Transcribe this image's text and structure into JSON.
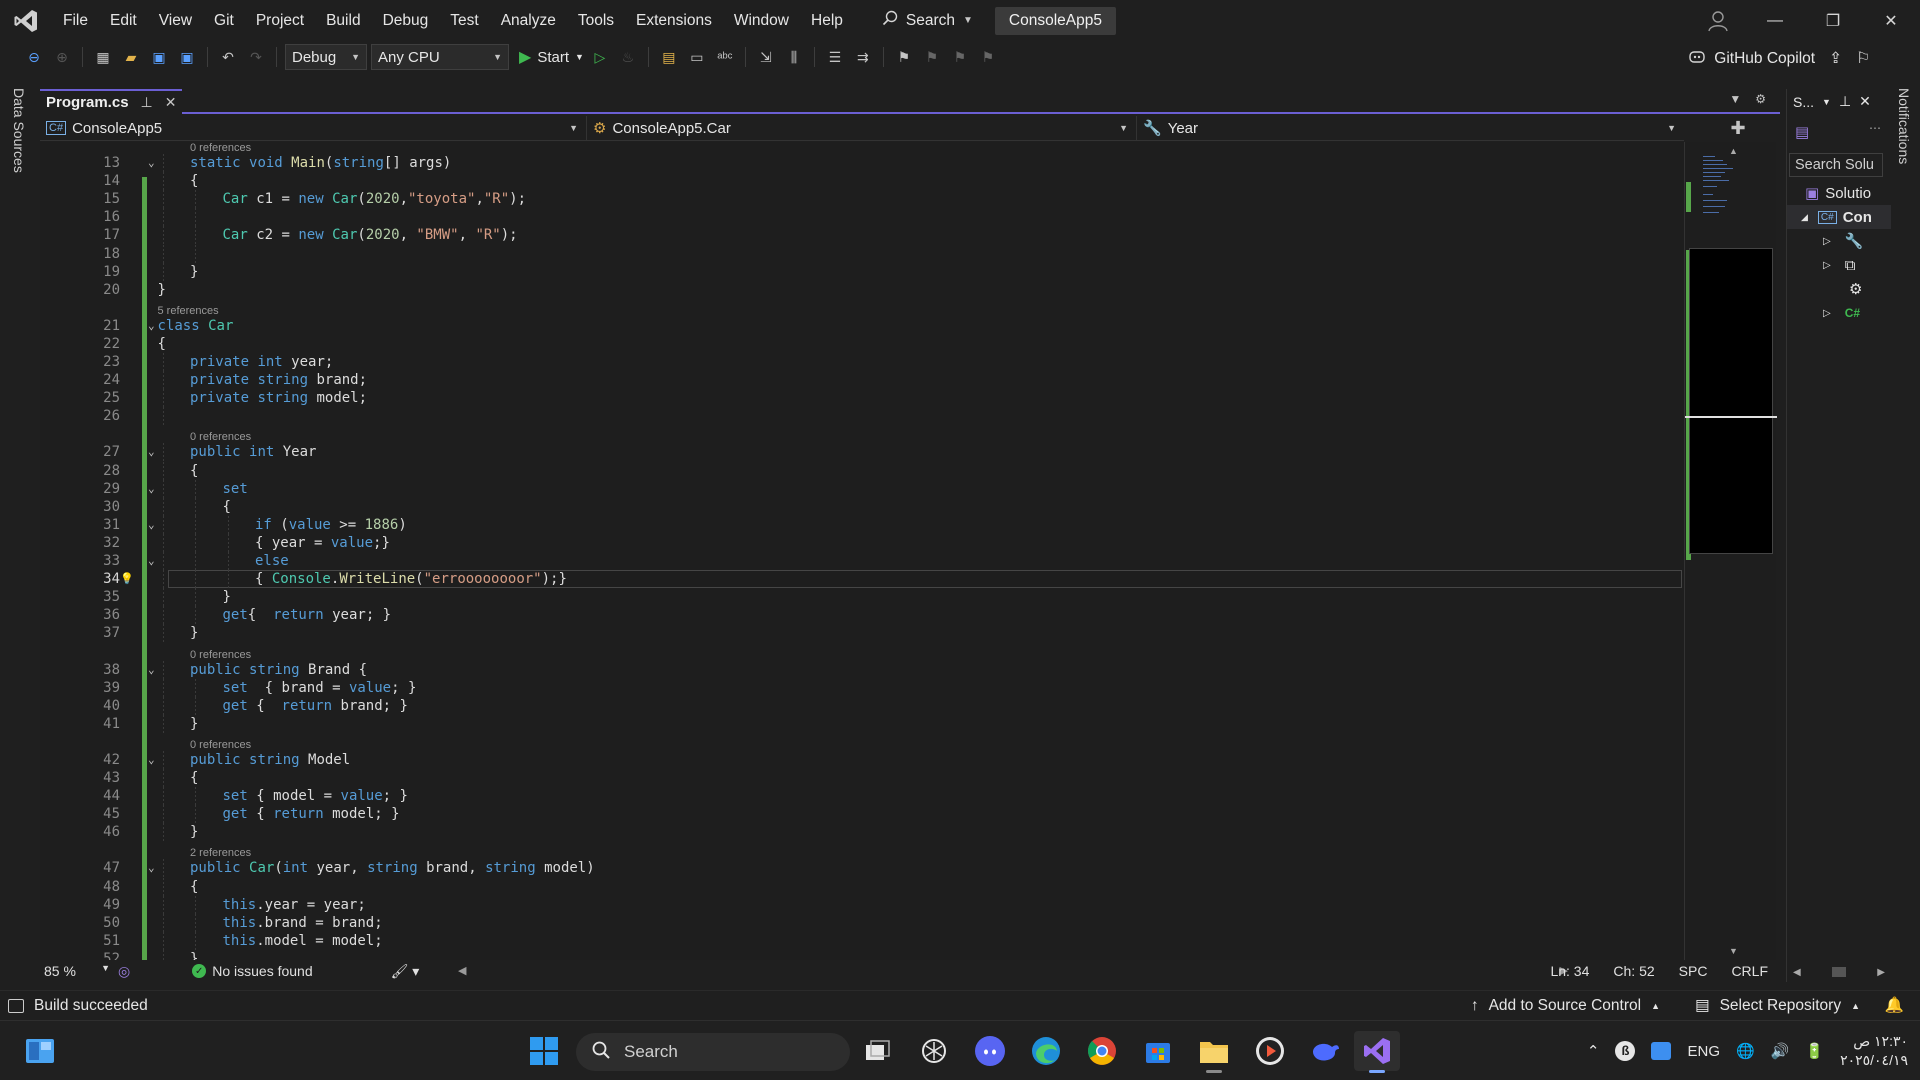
{
  "menu": {
    "items": [
      "File",
      "Edit",
      "View",
      "Git",
      "Project",
      "Build",
      "Debug",
      "Test",
      "Analyze",
      "Tools",
      "Extensions",
      "Window",
      "Help"
    ],
    "search_label": "Search",
    "solution_name": "ConsoleApp5"
  },
  "toolbar": {
    "configuration": "Debug",
    "platform": "Any CPU",
    "start_label": "Start",
    "copilot_label": "GitHub Copilot"
  },
  "side_tabs": {
    "left": "Data Sources",
    "right": "Notifications"
  },
  "editor": {
    "tab_title": "Program.cs",
    "nav_project": "ConsoleApp5",
    "nav_type": "ConsoleApp5.Car",
    "nav_member": "Year",
    "current_line": 34,
    "lines": [
      {
        "n": 13,
        "tokens": [
          [
            "k",
            "static"
          ],
          [
            "",
            " "
          ],
          [
            "k",
            "void"
          ],
          [
            "",
            " "
          ],
          [
            "m",
            "Main"
          ],
          [
            "",
            "("
          ],
          [
            "k",
            "string"
          ],
          [
            "",
            "[] "
          ],
          [
            "",
            "args"
          ],
          [
            "",
            ")"
          ]
        ],
        "indent": 2,
        "refs": "0 references"
      },
      {
        "n": 14,
        "tokens": [
          [
            "",
            "{"
          ]
        ],
        "indent": 2
      },
      {
        "n": 15,
        "tokens": [
          [
            "t",
            "Car"
          ],
          [
            "",
            " c1 = "
          ],
          [
            "k",
            "new"
          ],
          [
            "",
            " "
          ],
          [
            "t",
            "Car"
          ],
          [
            "",
            "("
          ],
          [
            "n",
            "2020"
          ],
          [
            "",
            ","
          ],
          [
            "s",
            "\"toyota\""
          ],
          [
            "",
            ","
          ],
          [
            "s",
            "\"R\""
          ],
          [
            "",
            ");"
          ]
        ],
        "indent": 3
      },
      {
        "n": 16,
        "tokens": [],
        "indent": 3
      },
      {
        "n": 17,
        "tokens": [
          [
            "t",
            "Car"
          ],
          [
            "",
            " c2 = "
          ],
          [
            "k",
            "new"
          ],
          [
            "",
            " "
          ],
          [
            "t",
            "Car"
          ],
          [
            "",
            "("
          ],
          [
            "n",
            "2020"
          ],
          [
            "",
            ", "
          ],
          [
            "s",
            "\"BMW\""
          ],
          [
            "",
            ", "
          ],
          [
            "s",
            "\"R\""
          ],
          [
            "",
            ");"
          ]
        ],
        "indent": 3
      },
      {
        "n": 18,
        "tokens": [],
        "indent": 3
      },
      {
        "n": 19,
        "tokens": [
          [
            "",
            "}"
          ]
        ],
        "indent": 2
      },
      {
        "n": 20,
        "tokens": [
          [
            "",
            "}"
          ]
        ],
        "indent": 1
      },
      {
        "n": 21,
        "tokens": [
          [
            "k",
            "class"
          ],
          [
            "",
            " "
          ],
          [
            "cls",
            "Car"
          ]
        ],
        "indent": 1,
        "refs": "5 references"
      },
      {
        "n": 22,
        "tokens": [
          [
            "",
            "{"
          ]
        ],
        "indent": 1
      },
      {
        "n": 23,
        "tokens": [
          [
            "k",
            "private"
          ],
          [
            "",
            " "
          ],
          [
            "k",
            "int"
          ],
          [
            "",
            " year;"
          ]
        ],
        "indent": 2
      },
      {
        "n": 24,
        "tokens": [
          [
            "k",
            "private"
          ],
          [
            "",
            " "
          ],
          [
            "k",
            "string"
          ],
          [
            "",
            " brand;"
          ]
        ],
        "indent": 2
      },
      {
        "n": 25,
        "tokens": [
          [
            "k",
            "private"
          ],
          [
            "",
            " "
          ],
          [
            "k",
            "string"
          ],
          [
            "",
            " model;"
          ]
        ],
        "indent": 2
      },
      {
        "n": 26,
        "tokens": [],
        "indent": 2
      },
      {
        "n": 27,
        "tokens": [
          [
            "k",
            "public"
          ],
          [
            "",
            " "
          ],
          [
            "k",
            "int"
          ],
          [
            "",
            " Year"
          ]
        ],
        "indent": 2,
        "refs": "0 references"
      },
      {
        "n": 28,
        "tokens": [
          [
            "",
            "{"
          ]
        ],
        "indent": 2
      },
      {
        "n": 29,
        "tokens": [
          [
            "k",
            "set"
          ]
        ],
        "indent": 3
      },
      {
        "n": 30,
        "tokens": [
          [
            "",
            "{"
          ]
        ],
        "indent": 3
      },
      {
        "n": 31,
        "tokens": [
          [
            "k",
            "if"
          ],
          [
            "",
            " ("
          ],
          [
            "k",
            "value"
          ],
          [
            "",
            " >= "
          ],
          [
            "n",
            "1886"
          ],
          [
            "",
            ")"
          ]
        ],
        "indent": 4
      },
      {
        "n": 32,
        "tokens": [
          [
            "",
            "{ year = "
          ],
          [
            "k",
            "value"
          ],
          [
            "",
            ";}"
          ]
        ],
        "indent": 4
      },
      {
        "n": 33,
        "tokens": [
          [
            "k",
            "else"
          ]
        ],
        "indent": 4
      },
      {
        "n": 34,
        "tokens": [
          [
            "",
            "{ "
          ],
          [
            "t",
            "Console"
          ],
          [
            "",
            "."
          ],
          [
            "m",
            "WriteLine"
          ],
          [
            "",
            "("
          ],
          [
            "s",
            "\"erroooooooor\""
          ],
          [
            "",
            ");}"
          ]
        ],
        "indent": 4
      },
      {
        "n": 35,
        "tokens": [
          [
            "",
            "}"
          ]
        ],
        "indent": 3
      },
      {
        "n": 36,
        "tokens": [
          [
            "k",
            "get"
          ],
          [
            "",
            "{  "
          ],
          [
            "k",
            "return"
          ],
          [
            "",
            " year; }"
          ]
        ],
        "indent": 3
      },
      {
        "n": 37,
        "tokens": [
          [
            "",
            "}"
          ]
        ],
        "indent": 2
      },
      {
        "n": 38,
        "tokens": [
          [
            "k",
            "public"
          ],
          [
            "",
            " "
          ],
          [
            "k",
            "string"
          ],
          [
            "",
            " Brand {"
          ]
        ],
        "indent": 2,
        "refs": "0 references"
      },
      {
        "n": 39,
        "tokens": [
          [
            "k",
            "set"
          ],
          [
            "",
            "  { brand = "
          ],
          [
            "k",
            "value"
          ],
          [
            "",
            "; }"
          ]
        ],
        "indent": 3
      },
      {
        "n": 40,
        "tokens": [
          [
            "k",
            "get"
          ],
          [
            "",
            " {  "
          ],
          [
            "k",
            "return"
          ],
          [
            "",
            " brand; }"
          ]
        ],
        "indent": 3
      },
      {
        "n": 41,
        "tokens": [
          [
            "",
            "}"
          ]
        ],
        "indent": 2
      },
      {
        "n": 42,
        "tokens": [
          [
            "k",
            "public"
          ],
          [
            "",
            " "
          ],
          [
            "k",
            "string"
          ],
          [
            "",
            " Model"
          ]
        ],
        "indent": 2,
        "refs": "0 references"
      },
      {
        "n": 43,
        "tokens": [
          [
            "",
            "{"
          ]
        ],
        "indent": 2
      },
      {
        "n": 44,
        "tokens": [
          [
            "k",
            "set"
          ],
          [
            "",
            " { model = "
          ],
          [
            "k",
            "value"
          ],
          [
            "",
            "; }"
          ]
        ],
        "indent": 3
      },
      {
        "n": 45,
        "tokens": [
          [
            "k",
            "get"
          ],
          [
            "",
            " { "
          ],
          [
            "k",
            "return"
          ],
          [
            "",
            " model; }"
          ]
        ],
        "indent": 3
      },
      {
        "n": 46,
        "tokens": [
          [
            "",
            "}"
          ]
        ],
        "indent": 2
      },
      {
        "n": 47,
        "tokens": [
          [
            "k",
            "public"
          ],
          [
            "",
            " "
          ],
          [
            "cls",
            "Car"
          ],
          [
            "",
            "("
          ],
          [
            "k",
            "int"
          ],
          [
            "",
            " year, "
          ],
          [
            "k",
            "string"
          ],
          [
            "",
            " brand, "
          ],
          [
            "k",
            "string"
          ],
          [
            "",
            " model)"
          ]
        ],
        "indent": 2,
        "refs": "2 references"
      },
      {
        "n": 48,
        "tokens": [
          [
            "",
            "{"
          ]
        ],
        "indent": 2
      },
      {
        "n": 49,
        "tokens": [
          [
            "k",
            "this"
          ],
          [
            "",
            ".year = year;"
          ]
        ],
        "indent": 3
      },
      {
        "n": 50,
        "tokens": [
          [
            "k",
            "this"
          ],
          [
            "",
            ".brand = brand;"
          ]
        ],
        "indent": 3
      },
      {
        "n": 51,
        "tokens": [
          [
            "k",
            "this"
          ],
          [
            "",
            ".model = model;"
          ]
        ],
        "indent": 3
      },
      {
        "n": 52,
        "tokens": [
          [
            "",
            "}"
          ]
        ],
        "indent": 2
      }
    ]
  },
  "editor_status": {
    "zoom": "85 %",
    "issues": "No issues found",
    "line": "Ln: 34",
    "char": "Ch: 52",
    "whitespace": "SPC",
    "line_ending": "CRLF"
  },
  "solution_explorer": {
    "header": "S...",
    "search_placeholder": "Search Solu",
    "solution_row": "Solutio",
    "project_row": "Con"
  },
  "status_bar": {
    "build": "Build succeeded",
    "source_control": "Add to Source Control",
    "repository": "Select Repository"
  },
  "taskbar": {
    "search_placeholder": "Search",
    "language": "ENG",
    "time": "١٢:٣٠ ص",
    "date": "٢٠٢٥/٠٤/١٩"
  },
  "colors": {
    "accent": "#6b5fd3",
    "change_bar": "#57a64a",
    "keyword": "#569cd6",
    "type": "#4ec9b0",
    "string": "#d69d85",
    "number": "#b5cea8",
    "method": "#dcdcaa"
  }
}
